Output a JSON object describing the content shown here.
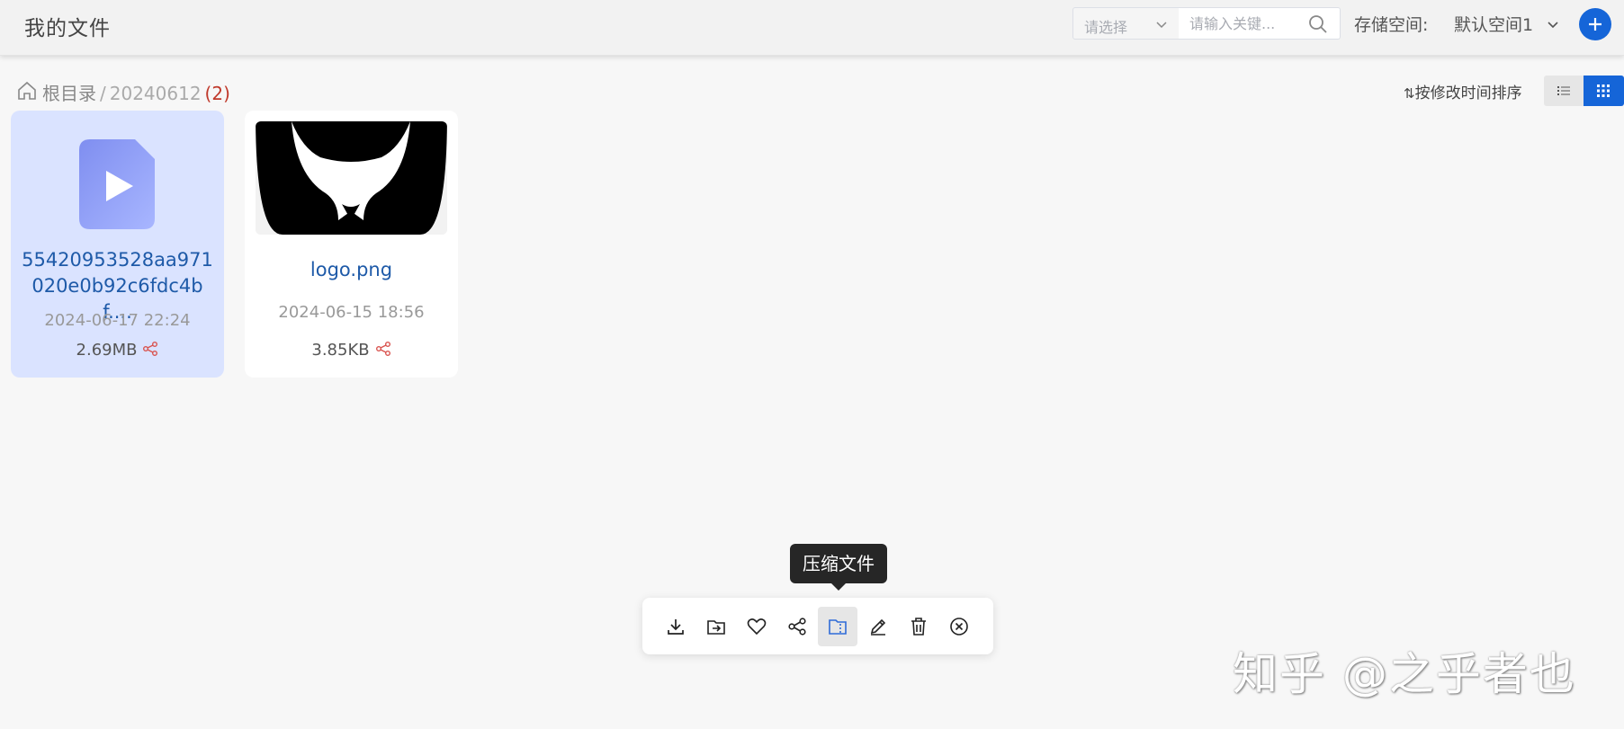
{
  "header": {
    "title": "我的文件",
    "select_placeholder": "请选择",
    "search_placeholder": "请输入关键...",
    "storage_label": "存储空间:",
    "storage_value": "默认空间1"
  },
  "breadcrumb": {
    "root": "根目录",
    "separator": "/",
    "current": "20240612",
    "count": "(2)"
  },
  "sort": {
    "label": "按修改时间排序"
  },
  "files": [
    {
      "name": "55420953528aa971020e0b92c6fdc4bf....",
      "date": "2024-06-17 22:24",
      "size": "2.69MB",
      "type": "video"
    },
    {
      "name": "logo.png",
      "date": "2024-06-15 18:56",
      "size": "3.85KB",
      "type": "image"
    }
  ],
  "tooltip": {
    "text": "压缩文件"
  },
  "toolbar": {
    "icons": [
      "download-icon",
      "move-icon",
      "favorite-icon",
      "share-icon",
      "compress-icon",
      "rename-icon",
      "delete-icon",
      "close-icon"
    ],
    "active": "compress-icon"
  },
  "watermark": "知乎 @之乎者也",
  "colors": {
    "accent": "#1565d8",
    "selected_card": "#dae3ff",
    "link": "#1e5aa8",
    "count": "#c0392b",
    "share": "#d9534f"
  }
}
